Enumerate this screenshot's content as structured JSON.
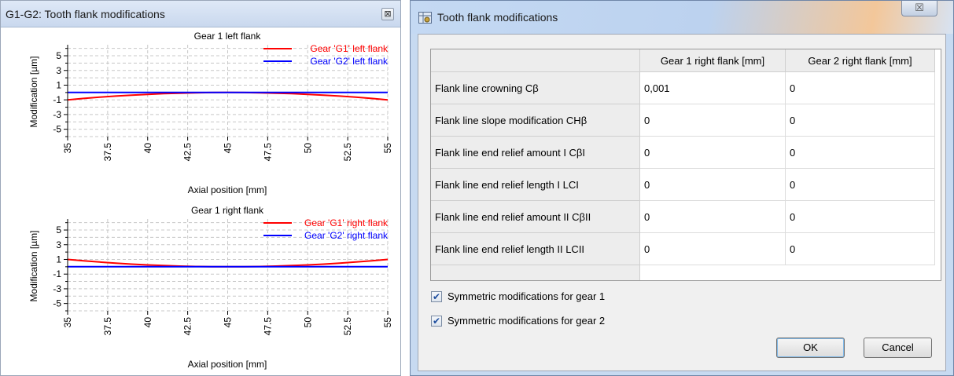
{
  "left_window": {
    "title": "G1-G2: Tooth flank modifications",
    "close_glyph": "⊠"
  },
  "chart_data": [
    {
      "type": "line",
      "title": "Gear 1 left flank",
      "xlabel": "Axial position [mm]",
      "ylabel": "Modification [µm]",
      "xlim": [
        35,
        55
      ],
      "ylim": [
        -6,
        6.5
      ],
      "x_ticks": [
        "35",
        "37.5",
        "40",
        "42.5",
        "45",
        "47.5",
        "50",
        "52.5",
        "55"
      ],
      "x_tick_values": [
        35,
        37.5,
        40,
        42.5,
        45,
        47.5,
        50,
        52.5,
        55
      ],
      "y_ticks": [
        "5",
        "3",
        "1",
        "-1",
        "-3",
        "-5"
      ],
      "y_tick_values": [
        5,
        3,
        1,
        -1,
        -3,
        -5
      ],
      "grid": true,
      "legend_position": "top-right",
      "series": [
        {
          "name": "Gear 'G1' left flank",
          "color": "#ff0000",
          "x": [
            35,
            36,
            37,
            38,
            39,
            40,
            41,
            42,
            43,
            44,
            45,
            46,
            47,
            48,
            49,
            50,
            51,
            52,
            53,
            54,
            55
          ],
          "y": [
            -1.0,
            -0.81,
            -0.64,
            -0.49,
            -0.36,
            -0.25,
            -0.16,
            -0.09,
            -0.04,
            -0.01,
            0,
            -0.01,
            -0.04,
            -0.09,
            -0.16,
            -0.25,
            -0.36,
            -0.49,
            -0.64,
            -0.81,
            -1.0
          ]
        },
        {
          "name": "Gear 'G2' left flank",
          "color": "#0000ff",
          "x": [
            35,
            55
          ],
          "y": [
            0,
            0
          ]
        }
      ]
    },
    {
      "type": "line",
      "title": "Gear 1 right flank",
      "xlabel": "Axial position [mm]",
      "ylabel": "Modification [µm]",
      "xlim": [
        35,
        55
      ],
      "ylim": [
        -6,
        6.5
      ],
      "x_ticks": [
        "35",
        "37.5",
        "40",
        "42.5",
        "45",
        "47.5",
        "50",
        "52.5",
        "55"
      ],
      "x_tick_values": [
        35,
        37.5,
        40,
        42.5,
        45,
        47.5,
        50,
        52.5,
        55
      ],
      "y_ticks": [
        "5",
        "3",
        "1",
        "-1",
        "-3",
        "-5"
      ],
      "y_tick_values": [
        5,
        3,
        1,
        -1,
        -3,
        -5
      ],
      "grid": true,
      "legend_position": "top-right",
      "series": [
        {
          "name": "Gear 'G1' right flank",
          "color": "#ff0000",
          "x": [
            35,
            36,
            37,
            38,
            39,
            40,
            41,
            42,
            43,
            44,
            45,
            46,
            47,
            48,
            49,
            50,
            51,
            52,
            53,
            54,
            55
          ],
          "y": [
            1.0,
            0.81,
            0.64,
            0.49,
            0.36,
            0.25,
            0.16,
            0.09,
            0.04,
            0.01,
            0,
            0.01,
            0.04,
            0.09,
            0.16,
            0.25,
            0.36,
            0.49,
            0.64,
            0.81,
            1.0
          ]
        },
        {
          "name": "Gear 'G2' right flank",
          "color": "#0000ff",
          "x": [
            35,
            55
          ],
          "y": [
            0,
            0
          ]
        }
      ]
    }
  ],
  "dialog": {
    "title": "Tooth flank modifications",
    "close_glyph": "☒",
    "table": {
      "columns": [
        "Gear 1 right flank [mm]",
        "Gear 2 right flank [mm]"
      ],
      "rows": [
        {
          "label": "Flank line crowning Cβ",
          "g1": "0,001",
          "g2": "0"
        },
        {
          "label": "Flank line slope modification CHβ",
          "g1": "0",
          "g2": "0"
        },
        {
          "label": "Flank line end relief amount I CβI",
          "g1": "0",
          "g2": "0"
        },
        {
          "label": "Flank line end relief length I LCI",
          "g1": "0",
          "g2": "0"
        },
        {
          "label": "Flank line end relief amount II CβII",
          "g1": "0",
          "g2": "0"
        },
        {
          "label": "Flank line end relief length II LCII",
          "g1": "0",
          "g2": "0"
        }
      ]
    },
    "symmetric_gear1": {
      "label": "Symmetric modifications for gear 1",
      "checked": true
    },
    "symmetric_gear2": {
      "label": "Symmetric modifications for gear 2",
      "checked": true
    },
    "check_glyph": "✔",
    "ok_label": "OK",
    "cancel_label": "Cancel"
  }
}
